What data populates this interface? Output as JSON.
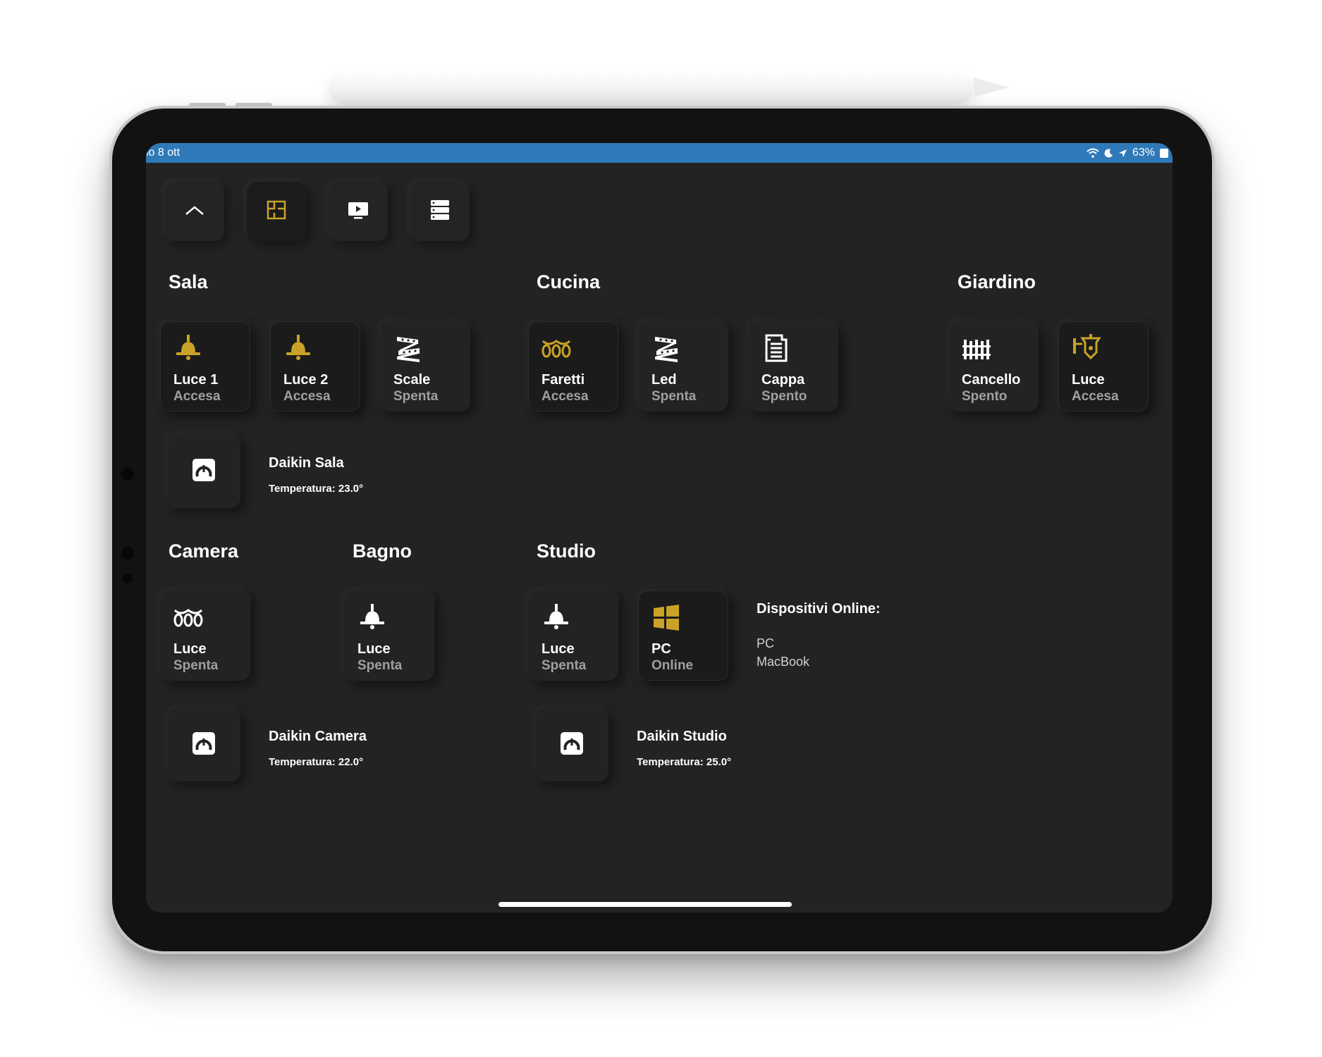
{
  "statusbar": {
    "date": "io 8 ott",
    "battery": "63%",
    "icons": [
      "wifi-icon",
      "moon-icon",
      "location-arrow-icon",
      "battery-icon"
    ]
  },
  "toolbar": {
    "buttons": [
      {
        "name": "collapse",
        "icon": "chevron-up-icon"
      },
      {
        "name": "floorplan",
        "icon": "floorplan-icon",
        "selected": true
      },
      {
        "name": "media",
        "icon": "play-icon"
      },
      {
        "name": "server",
        "icon": "server-icon"
      }
    ]
  },
  "colors": {
    "accent": "#c9a227",
    "background": "#232323",
    "statusbar": "#2f79b8",
    "text_secondary": "#a0a0a0"
  },
  "rooms": {
    "sala": {
      "title": "Sala",
      "tiles": [
        {
          "name": "Luce 1",
          "state": "Accesa",
          "icon": "ceiling-lamp-icon",
          "on": true
        },
        {
          "name": "Luce 2",
          "state": "Accesa",
          "icon": "ceiling-lamp-icon",
          "on": true
        },
        {
          "name": "Scale",
          "state": "Spenta",
          "icon": "led-strip-icon",
          "on": false
        }
      ],
      "climate": {
        "name": "Daikin Sala",
        "temperature": "Temperatura: 23.0°",
        "icon": "air-conditioner-icon"
      }
    },
    "cucina": {
      "title": "Cucina",
      "tiles": [
        {
          "name": "Faretti",
          "state": "Accesa",
          "icon": "string-lights-icon",
          "on": true
        },
        {
          "name": "Led",
          "state": "Spenta",
          "icon": "led-strip-icon",
          "on": false
        },
        {
          "name": "Cappa",
          "state": "Spento",
          "icon": "range-hood-icon",
          "on": false
        }
      ]
    },
    "giardino": {
      "title": "Giardino",
      "tiles": [
        {
          "name": "Cancello",
          "state": "Spento",
          "icon": "gate-icon",
          "on": false
        },
        {
          "name": "Luce",
          "state": "Accesa",
          "icon": "wall-lantern-icon",
          "on": true
        }
      ]
    },
    "camera": {
      "title": "Camera",
      "tiles": [
        {
          "name": "Luce",
          "state": "Spenta",
          "icon": "string-lights-icon",
          "on": false
        }
      ],
      "climate": {
        "name": "Daikin Camera",
        "temperature": "Temperatura: 22.0°",
        "icon": "air-conditioner-icon"
      }
    },
    "bagno": {
      "title": "Bagno",
      "tiles": [
        {
          "name": "Luce",
          "state": "Spenta",
          "icon": "ceiling-lamp-icon",
          "on": false
        }
      ]
    },
    "studio": {
      "title": "Studio",
      "tiles": [
        {
          "name": "Luce",
          "state": "Spenta",
          "icon": "ceiling-lamp-icon",
          "on": false
        },
        {
          "name": "PC",
          "state": "Online",
          "icon": "windows-icon",
          "on": true
        }
      ],
      "climate": {
        "name": "Daikin Studio",
        "temperature": "Temperatura: 25.0°",
        "icon": "air-conditioner-icon"
      },
      "online": {
        "title": "Dispositivi Online:",
        "devices": [
          "PC",
          "MacBook"
        ]
      }
    }
  }
}
